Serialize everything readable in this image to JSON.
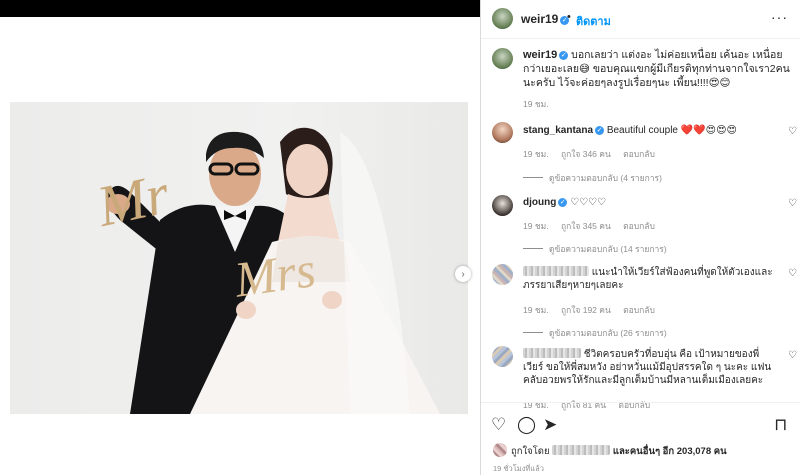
{
  "post": {
    "username": "weir19",
    "verified_mark": "✓",
    "dot": "•",
    "follow_label": "ติดตาม",
    "more_label": "···",
    "caption_text": "บอกเลยว่า แต่งอะ ไม่ค่อยเหนื่อย เค้นอะ เหนื่อยกว่าเยอะเลย😅 ขอบคุณแขกผู้มีเกียรติทุกท่านจากใจเรา2คนนะครับ ไว้จะค่อยๆลงรูปเรื่อยๆนะ เพี้ยน!!!!😍😊",
    "caption_time": "19 ชม."
  },
  "comments": [
    {
      "username": "stang_kantana",
      "verified": true,
      "text": "Beautiful couple ❤️❤️😍😍😍",
      "time": "19 ชม.",
      "likes": "ถูกใจ 346 คน",
      "reply_label": "ตอบกลับ",
      "view_replies": "ดูข้อความตอบกลับ (4 รายการ)"
    },
    {
      "username": "djoung",
      "verified": true,
      "text": "♡♡♡♡",
      "time": "19 ชม.",
      "likes": "ถูกใจ 345 คน",
      "reply_label": "ตอบกลับ",
      "view_replies": "ดูข้อความตอบกลับ (14 รายการ)"
    },
    {
      "username": "",
      "verified": false,
      "text": "แนะนำให้เวียร์ใส่ฟ้องคนที่พูดให้ตัวเองและภรรยาเสียๆหายๆเลยคะ",
      "time": "19 ชม.",
      "likes": "ถูกใจ 192 คน",
      "reply_label": "ตอบกลับ",
      "view_replies": "ดูข้อความตอบกลับ (26 รายการ)"
    },
    {
      "username": "",
      "verified": false,
      "text": "ชีวิตครอบครัวที่อบอุ่น คือ เป้าหมายของพี่เวียร์ ขอให้พี่สมหวัง อย่าหวั่นแม้มีอุปสรรคใด ๆ นะคะ แฟนคลับอวยพรให้รักและมีลูกเต็มบ้านมีหลานเต็มเมืองเลยคะ",
      "time": "19 ชม.",
      "likes": "ถูกใจ 81 คน",
      "reply_label": "ตอบกลับ"
    }
  ],
  "footer": {
    "likes_prefix": "ถูกใจโดย",
    "likes_suffix": "และคนอื่นๆ อีก 203,078 คน",
    "time": "19 ชั่วโมงที่แล้ว"
  },
  "icons": {
    "heart": "heart-icon",
    "comment": "comment-icon",
    "share": "share-icon",
    "save": "bookmark-icon",
    "next": "chevron-right-icon"
  },
  "colors": {
    "link_blue": "#0095f6",
    "verified_blue": "#3897f0",
    "meta_gray": "#8e8e8e"
  }
}
